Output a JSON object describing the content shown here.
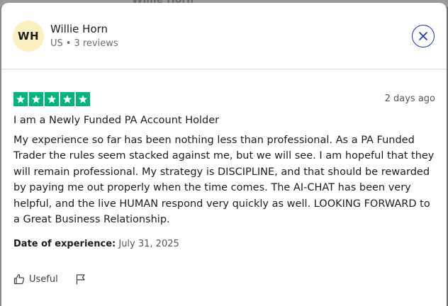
{
  "backdrop": {
    "peek_text": "Willie Horn"
  },
  "reviewer": {
    "initials": "WH",
    "name": "Willie Horn",
    "country": "US",
    "review_count": "3 reviews"
  },
  "review": {
    "rating": 5,
    "date_ago": "2 days ago",
    "title": "I am a Newly Funded PA Account Holder",
    "body": "My experience so far has been nothing less than professional. As a PA Funded Trader the rules seem stacked against me, but we will see. I am hopeful that they will remain professional. My strategy is DISCIPLINE, and that should be rewarded by paying me out properly when the time comes. The AI-CHAT has been very helpful, and the live HUMAN respond very quickly as well. LOOKING FORWARD to a Great Business Relationship.",
    "experience_label": "Date of experience:",
    "experience_date": "July 31, 2025"
  },
  "actions": {
    "useful_label": "Useful",
    "useful_icon": "thumbs-up-icon",
    "flag_icon": "flag-icon"
  },
  "colors": {
    "star_green": "#00b67a",
    "close_blue": "#1b2dbf",
    "avatar_bg": "#fcefc0"
  }
}
